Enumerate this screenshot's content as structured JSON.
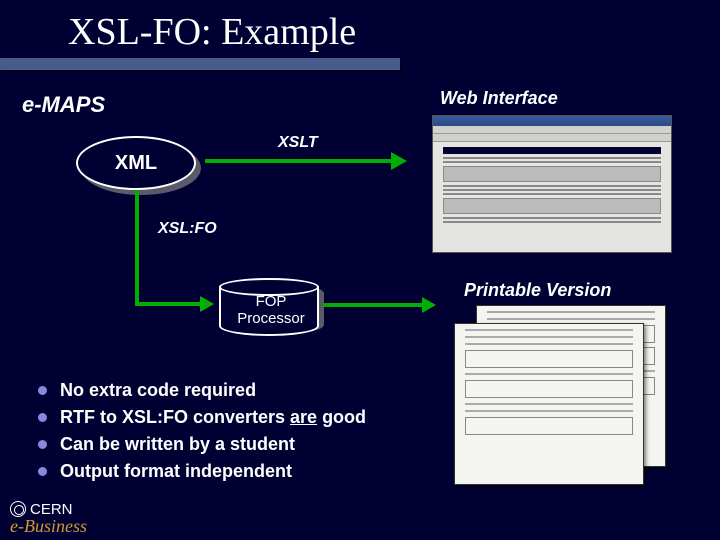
{
  "title": "XSL-FO: Example",
  "labels": {
    "emaps": "e-MAPS",
    "web_interface": "Web Interface",
    "printable": "Printable Version",
    "xml": "XML",
    "xslt": "XSLT",
    "xslfo": "XSL:FO",
    "fop_line1": "FOP",
    "fop_line2": "Processor"
  },
  "bullets": [
    "No extra code required",
    "RTF to XSL:FO converters ",
    "Can be written by a student",
    "Output format independent"
  ],
  "bullet2_underlined": "are",
  "bullet2_after": " good",
  "footer": {
    "cern": "CERN",
    "ebiz_e": "e-",
    "ebiz_rest": "Business"
  }
}
